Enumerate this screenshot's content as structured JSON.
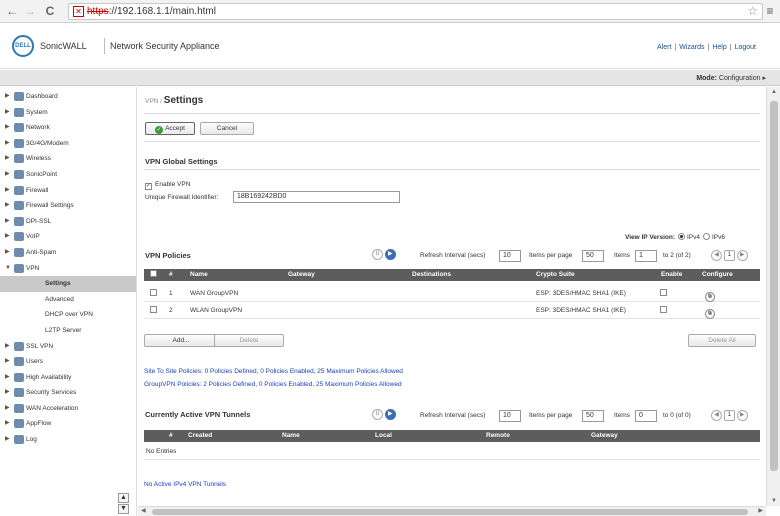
{
  "browser": {
    "url_scheme": "https",
    "url_rest": "://192.168.1.1/main.html",
    "back": "←",
    "forward": "→",
    "reload": "C",
    "star": "☆",
    "menu": "≡",
    "lock_glyph": "✕"
  },
  "header": {
    "logo": "DELL",
    "brand": "SonicWALL",
    "product": "Network Security Appliance",
    "links": [
      "Alert",
      "Wizards",
      "Help",
      "Logout"
    ],
    "link_sep": "|"
  },
  "modebar": {
    "label": "Mode:",
    "value": "Configuration ▸"
  },
  "sidebar": {
    "items": [
      {
        "label": "Dashboard",
        "arrow": "▶"
      },
      {
        "label": "System",
        "arrow": "▶"
      },
      {
        "label": "Network",
        "arrow": "▶"
      },
      {
        "label": "3G/4G/Modem",
        "arrow": "▶"
      },
      {
        "label": "Wireless",
        "arrow": "▶"
      },
      {
        "label": "SonicPoint",
        "arrow": "▶"
      },
      {
        "label": "Firewall",
        "arrow": "▶"
      },
      {
        "label": "Firewall Settings",
        "arrow": "▶"
      },
      {
        "label": "DPI-SSL",
        "arrow": "▶"
      },
      {
        "label": "VoIP",
        "arrow": "▶"
      },
      {
        "label": "Anti-Spam",
        "arrow": "▶"
      },
      {
        "label": "VPN",
        "arrow": "▼"
      }
    ],
    "vpn_sub": [
      "Settings",
      "Advanced",
      "DHCP over VPN",
      "L2TP Server"
    ],
    "items_after": [
      {
        "label": "SSL VPN",
        "arrow": "▶"
      },
      {
        "label": "Users",
        "arrow": "▶"
      },
      {
        "label": "High Availability",
        "arrow": "▶"
      },
      {
        "label": "Security Services",
        "arrow": "▶"
      },
      {
        "label": "WAN Acceleration",
        "arrow": "▶"
      },
      {
        "label": "AppFlow",
        "arrow": "▶"
      },
      {
        "label": "Log",
        "arrow": "▶"
      }
    ],
    "scroll_up": "▲",
    "scroll_down": "▼"
  },
  "main": {
    "crumb_parent": "VPN /",
    "crumb_title": "Settings",
    "accept": "Accept",
    "cancel": "Cancel",
    "global_title": "VPN Global Settings",
    "enable_vpn": "Enable VPN",
    "uid_label": "Unique Firewall Identifier:",
    "uid_value": "18B169242BD0",
    "view_ip_label": "View IP Version:",
    "ipv4": "IPv4",
    "ipv6": "IPv6",
    "policies_title": "VPN Policies",
    "refresh_label": "Refresh Interval (secs)",
    "refresh_value": "10",
    "ipp_label": "Items per page",
    "ipp_value": "50",
    "items_label": "Items",
    "items_value": "1",
    "items_range": "to 2 (of 2)",
    "page": "1",
    "columns": [
      "#",
      "Name",
      "Gateway",
      "Destinations",
      "Crypto Suite",
      "Enable",
      "Configure"
    ],
    "rows": [
      {
        "num": "1",
        "name": "WAN GroupVPN",
        "crypto": "ESP: 3DES/HMAC SHA1 (IKE)"
      },
      {
        "num": "2",
        "name": "WLAN GroupVPN",
        "crypto": "ESP: 3DES/HMAC SHA1 (IKE)"
      }
    ],
    "add": "Add...",
    "delete": "Delete",
    "delete_all": "Delete All",
    "info1": "Site To Site Policies: 0 Policies Defined, 0 Policies Enabled, 25 Maximum Policies Allowed",
    "info2": "GroupVPN Policies: 2 Policies Defined, 0 Policies Enabled, 25 Maximum Policies Allowed",
    "tunnels_title": "Currently Active VPN Tunnels",
    "t_refresh_value": "10",
    "t_ipp_value": "50",
    "t_items_value": "0",
    "t_items_range": "to 0 (of 0)",
    "t_page": "1",
    "t_columns": [
      "#",
      "Created",
      "Name",
      "Local",
      "Remote",
      "Gateway"
    ],
    "no_entries": "No Entries",
    "no_tunnels": "No Active IPv4 VPN Tunnels"
  }
}
